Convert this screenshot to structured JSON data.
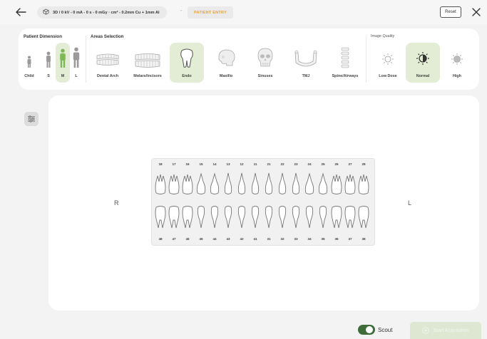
{
  "header": {
    "exposure_info": "3D / 0 kV - 0 mA - 0 s - 0 mGy · cm² - 0.2mm Cu + 1mm Al",
    "separator": "-",
    "patient_entry": "PATIENT ENTRY",
    "reset_label": "Reset"
  },
  "patient_dimension": {
    "title": "Patient Dimension",
    "options": [
      {
        "label": "Child",
        "selected": false
      },
      {
        "label": "S",
        "selected": false
      },
      {
        "label": "M",
        "selected": true
      },
      {
        "label": "L",
        "selected": false
      }
    ]
  },
  "areas_selection": {
    "title": "Areas Selection",
    "options": [
      {
        "label": "Dental Arch",
        "icon": "dental-arch-icon",
        "selected": false
      },
      {
        "label": "Molars/Incisors",
        "icon": "molars-incisors-icon",
        "selected": false
      },
      {
        "label": "Endo",
        "icon": "tooth-icon",
        "selected": true
      },
      {
        "label": "Maxillo",
        "icon": "skull-profile-icon",
        "selected": false
      },
      {
        "label": "Sinuses",
        "icon": "skull-front-icon",
        "selected": false
      },
      {
        "label": "TMJ",
        "icon": "jaw-joint-icon",
        "selected": false
      },
      {
        "label": "Spine/Airways",
        "icon": "spine-icon",
        "selected": false
      }
    ]
  },
  "image_quality": {
    "title": "Image Quality",
    "options": [
      {
        "label": "Low Dose",
        "icon": "low-dose-icon",
        "selected": false
      },
      {
        "label": "Normal",
        "icon": "normal-quality-icon",
        "selected": true
      },
      {
        "label": "High",
        "icon": "high-quality-icon",
        "selected": false
      }
    ]
  },
  "viewer": {
    "right_label": "R",
    "left_label": "L",
    "upper_teeth": [
      "18",
      "17",
      "16",
      "15",
      "14",
      "13",
      "12",
      "11",
      "21",
      "22",
      "23",
      "24",
      "25",
      "26",
      "27",
      "28"
    ],
    "lower_teeth": [
      "48",
      "47",
      "46",
      "45",
      "44",
      "43",
      "42",
      "41",
      "31",
      "32",
      "33",
      "34",
      "35",
      "36",
      "37",
      "38"
    ]
  },
  "footer": {
    "scout_label": "Scout",
    "scout_on": true,
    "start_label": "Start Acquisition"
  },
  "colors": {
    "accent": "#3f6d3a",
    "selected_bg": "#e3ecd4",
    "patient_entry": "#e8a23c"
  }
}
